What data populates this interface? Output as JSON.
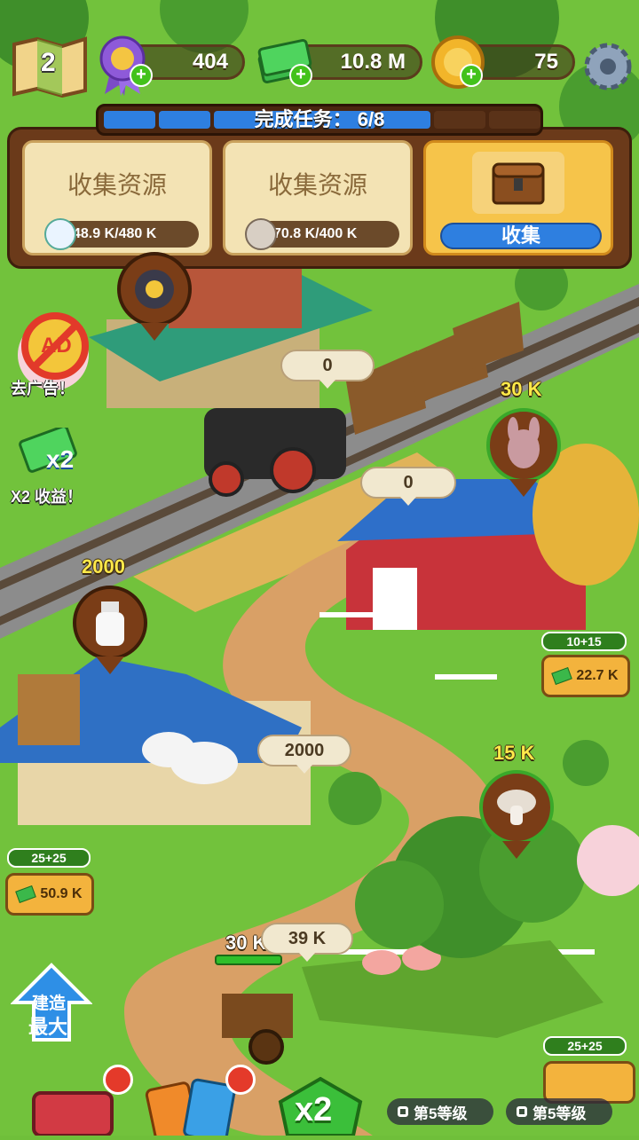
{
  "top_bar": {
    "map_level": "2",
    "ribbon_value": "404",
    "cash_value": "10.8 M",
    "coin_value": "75"
  },
  "mission": {
    "header": "完成任务：  6/8",
    "tasks": [
      {
        "title": "收集资源",
        "progress": "48.9 K/480 K",
        "resource": "milk-icon"
      },
      {
        "title": "收集资源",
        "progress": "70.8 K/400 K",
        "resource": "mushroom-icon"
      },
      {
        "title": "",
        "button": "收集",
        "resource": "chest-icon"
      }
    ]
  },
  "ads": {
    "remove_ads_label": "去广告！",
    "ad_badge": "AD",
    "x2_badge": "x2",
    "x2_label": "X2 收益！"
  },
  "train": {
    "bubble": "0"
  },
  "barn": {
    "bubble": "0",
    "pin_value": "30 K",
    "level": "10+15",
    "earn": "22.7 K"
  },
  "milk": {
    "pin_value": "2000"
  },
  "cows": {
    "bubble": "2000",
    "level": "25+25",
    "earn": "50.9 K"
  },
  "mushroom": {
    "pin_value": "15 K"
  },
  "cart": {
    "value": "30 K",
    "bubble": "39 K"
  },
  "bottom_right": {
    "level": "25+25"
  },
  "build_button": {
    "line1": "建造",
    "line2": "最大"
  },
  "bottom": {
    "x2_badge": "x2",
    "lock1": "第5等级",
    "lock2": "第5等级"
  },
  "colors": {
    "grass": "#6fbf3a",
    "path": "#d9a066",
    "panel": "#6b3a1a",
    "accent_blue": "#2e7fe0"
  }
}
